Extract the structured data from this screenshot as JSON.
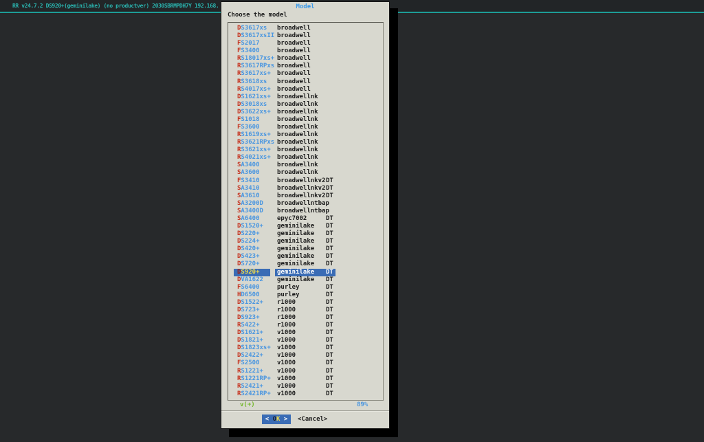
{
  "statusbar": {
    "text": "RR v24.7.2 DS920+(geminilake) (no productver) 2030SBRMPDH7Y 192.168."
  },
  "dialog": {
    "title": "Model",
    "prompt": "Choose the model",
    "scroll_indicator": "v(+)",
    "scroll_percent": "89%",
    "buttons": {
      "ok": {
        "prefix": "< ",
        "hotkey": "O",
        "label_rest": "K",
        "suffix": " >"
      },
      "cancel_label": "<Cancel>"
    },
    "list": {
      "selected_index": 32,
      "items": [
        {
          "model": "DS3617xs",
          "arch": "broadwell",
          "dt": ""
        },
        {
          "model": "DS3617xsII",
          "arch": "broadwell",
          "dt": ""
        },
        {
          "model": "FS2017",
          "arch": "broadwell",
          "dt": ""
        },
        {
          "model": "FS3400",
          "arch": "broadwell",
          "dt": ""
        },
        {
          "model": "RS18017xs+",
          "arch": "broadwell",
          "dt": ""
        },
        {
          "model": "RS3617RPxs",
          "arch": "broadwell",
          "dt": ""
        },
        {
          "model": "RS3617xs+",
          "arch": "broadwell",
          "dt": ""
        },
        {
          "model": "RS3618xs",
          "arch": "broadwell",
          "dt": ""
        },
        {
          "model": "RS4017xs+",
          "arch": "broadwell",
          "dt": ""
        },
        {
          "model": "DS1621xs+",
          "arch": "broadwellnk",
          "dt": ""
        },
        {
          "model": "DS3018xs",
          "arch": "broadwellnk",
          "dt": ""
        },
        {
          "model": "DS3622xs+",
          "arch": "broadwellnk",
          "dt": ""
        },
        {
          "model": "FS1018",
          "arch": "broadwellnk",
          "dt": ""
        },
        {
          "model": "FS3600",
          "arch": "broadwellnk",
          "dt": ""
        },
        {
          "model": "RS1619xs+",
          "arch": "broadwellnk",
          "dt": ""
        },
        {
          "model": "RS3621RPxs",
          "arch": "broadwellnk",
          "dt": ""
        },
        {
          "model": "RS3621xs+",
          "arch": "broadwellnk",
          "dt": ""
        },
        {
          "model": "RS4021xs+",
          "arch": "broadwellnk",
          "dt": ""
        },
        {
          "model": "SA3400",
          "arch": "broadwellnk",
          "dt": ""
        },
        {
          "model": "SA3600",
          "arch": "broadwellnk",
          "dt": ""
        },
        {
          "model": "FS3410",
          "arch": "broadwellnkv2",
          "dt": "DT"
        },
        {
          "model": "SA3410",
          "arch": "broadwellnkv2",
          "dt": "DT"
        },
        {
          "model": "SA3610",
          "arch": "broadwellnkv2",
          "dt": "DT"
        },
        {
          "model": "SA3200D",
          "arch": "broadwellntbap",
          "dt": ""
        },
        {
          "model": "SA3400D",
          "arch": "broadwellntbap",
          "dt": ""
        },
        {
          "model": "SA6400",
          "arch": "epyc7002",
          "dt": "DT"
        },
        {
          "model": "DS1520+",
          "arch": "geminilake",
          "dt": "DT"
        },
        {
          "model": "DS220+",
          "arch": "geminilake",
          "dt": "DT"
        },
        {
          "model": "DS224+",
          "arch": "geminilake",
          "dt": "DT"
        },
        {
          "model": "DS420+",
          "arch": "geminilake",
          "dt": "DT"
        },
        {
          "model": "DS423+",
          "arch": "geminilake",
          "dt": "DT"
        },
        {
          "model": "DS720+",
          "arch": "geminilake",
          "dt": "DT"
        },
        {
          "model": "DS920+",
          "arch": "geminilake",
          "dt": "DT"
        },
        {
          "model": "DVA1622",
          "arch": "geminilake",
          "dt": "DT"
        },
        {
          "model": "FS6400",
          "arch": "purley",
          "dt": "DT"
        },
        {
          "model": "HD6500",
          "arch": "purley",
          "dt": "DT"
        },
        {
          "model": "DS1522+",
          "arch": "r1000",
          "dt": "DT"
        },
        {
          "model": "DS723+",
          "arch": "r1000",
          "dt": "DT"
        },
        {
          "model": "DS923+",
          "arch": "r1000",
          "dt": "DT"
        },
        {
          "model": "RS422+",
          "arch": "r1000",
          "dt": "DT"
        },
        {
          "model": "DS1621+",
          "arch": "v1000",
          "dt": "DT"
        },
        {
          "model": "DS1821+",
          "arch": "v1000",
          "dt": "DT"
        },
        {
          "model": "DS1823xs+",
          "arch": "v1000",
          "dt": "DT"
        },
        {
          "model": "DS2422+",
          "arch": "v1000",
          "dt": "DT"
        },
        {
          "model": "FS2500",
          "arch": "v1000",
          "dt": "DT"
        },
        {
          "model": "RS1221+",
          "arch": "v1000",
          "dt": "DT"
        },
        {
          "model": "RS1221RP+",
          "arch": "v1000",
          "dt": "DT"
        },
        {
          "model": "RS2421+",
          "arch": "v1000",
          "dt": "DT"
        },
        {
          "model": "RS2421RP+",
          "arch": "v1000",
          "dt": "DT"
        }
      ]
    }
  },
  "colors": {
    "accent_teal": "#1d9c96",
    "statusbar_text": "#2ab3ae",
    "dialog_bg": "#d8d8cf",
    "model_letter_red": "#c5331f",
    "model_name_blue": "#4a96e0",
    "selection_bg": "#3a6cb5",
    "selection_yellow": "#eed94a",
    "scroll_green": "#74b72c"
  }
}
